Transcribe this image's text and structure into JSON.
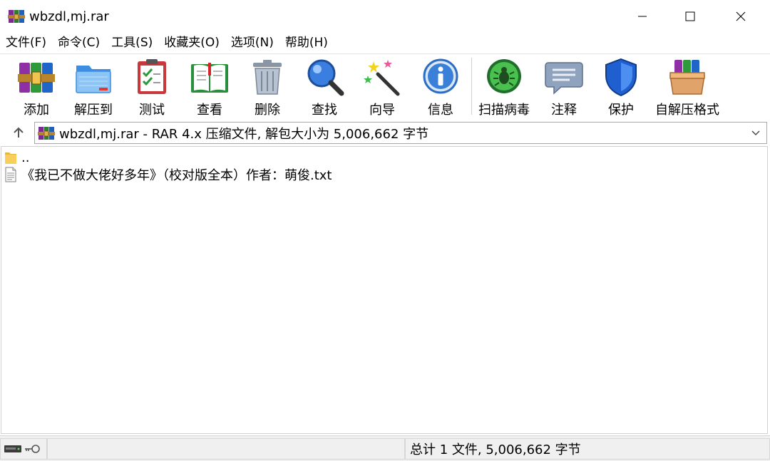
{
  "window": {
    "title": "wbzdl,mj.rar"
  },
  "menu": [
    {
      "label": "文件(F)"
    },
    {
      "label": "命令(C)"
    },
    {
      "label": "工具(S)"
    },
    {
      "label": "收藏夹(O)"
    },
    {
      "label": "选项(N)"
    },
    {
      "label": "帮助(H)"
    }
  ],
  "toolbar": {
    "add": "添加",
    "extract": "解压到",
    "test": "测试",
    "view": "查看",
    "delete": "删除",
    "find": "查找",
    "wizard": "向导",
    "info": "信息",
    "scan": "扫描病毒",
    "comment": "注释",
    "protect": "保护",
    "sfx": "自解压格式"
  },
  "address": {
    "text": "wbzdl,mj.rar - RAR 4.x 压缩文件, 解包大小为 5,006,662 字节"
  },
  "files": [
    {
      "name": "..",
      "icon": "folder-icon"
    },
    {
      "name": "《我已不做大佬好多年》（校对版全本）作者：萌俊.txt",
      "icon": "text-file-icon"
    }
  ],
  "status": {
    "summary": "总计 1 文件, 5,006,662 字节"
  },
  "colors": {
    "accent_blue": "#2b78d6",
    "status_bg": "#f0f0f0"
  }
}
